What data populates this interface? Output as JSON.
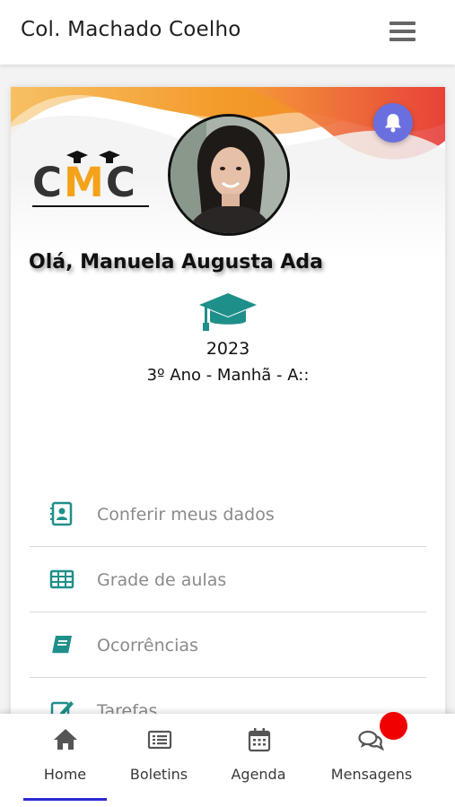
{
  "app": {
    "title": "Col. Machado Coelho"
  },
  "logo": {
    "text": "CMC"
  },
  "profile": {
    "greeting": "Olá, Manuela Augusta Ada",
    "year": "2023",
    "class_info": "3º Ano - Manhã - A::"
  },
  "menu": [
    {
      "label": "Conferir meus dados",
      "icon": "contact-book-icon"
    },
    {
      "label": "Grade de aulas",
      "icon": "table-grid-icon"
    },
    {
      "label": "Ocorrências",
      "icon": "book-icon"
    },
    {
      "label": "Tarefas",
      "icon": "edit-note-icon"
    }
  ],
  "bottom_nav": [
    {
      "label": "Home",
      "icon": "home-icon",
      "active": true
    },
    {
      "label": "Boletins",
      "icon": "list-card-icon",
      "active": false
    },
    {
      "label": "Agenda",
      "icon": "calendar-icon",
      "active": false
    },
    {
      "label": "Mensagens",
      "icon": "chat-bubbles-icon",
      "active": false
    }
  ],
  "colors": {
    "accent_teal": "#1f8f8a",
    "wave_orange": "#f5a623",
    "wave_red": "#ea4b4b",
    "bell_button": "#6a6fe0",
    "active_underline": "#2a2ad0",
    "badge_red": "#f00000"
  }
}
